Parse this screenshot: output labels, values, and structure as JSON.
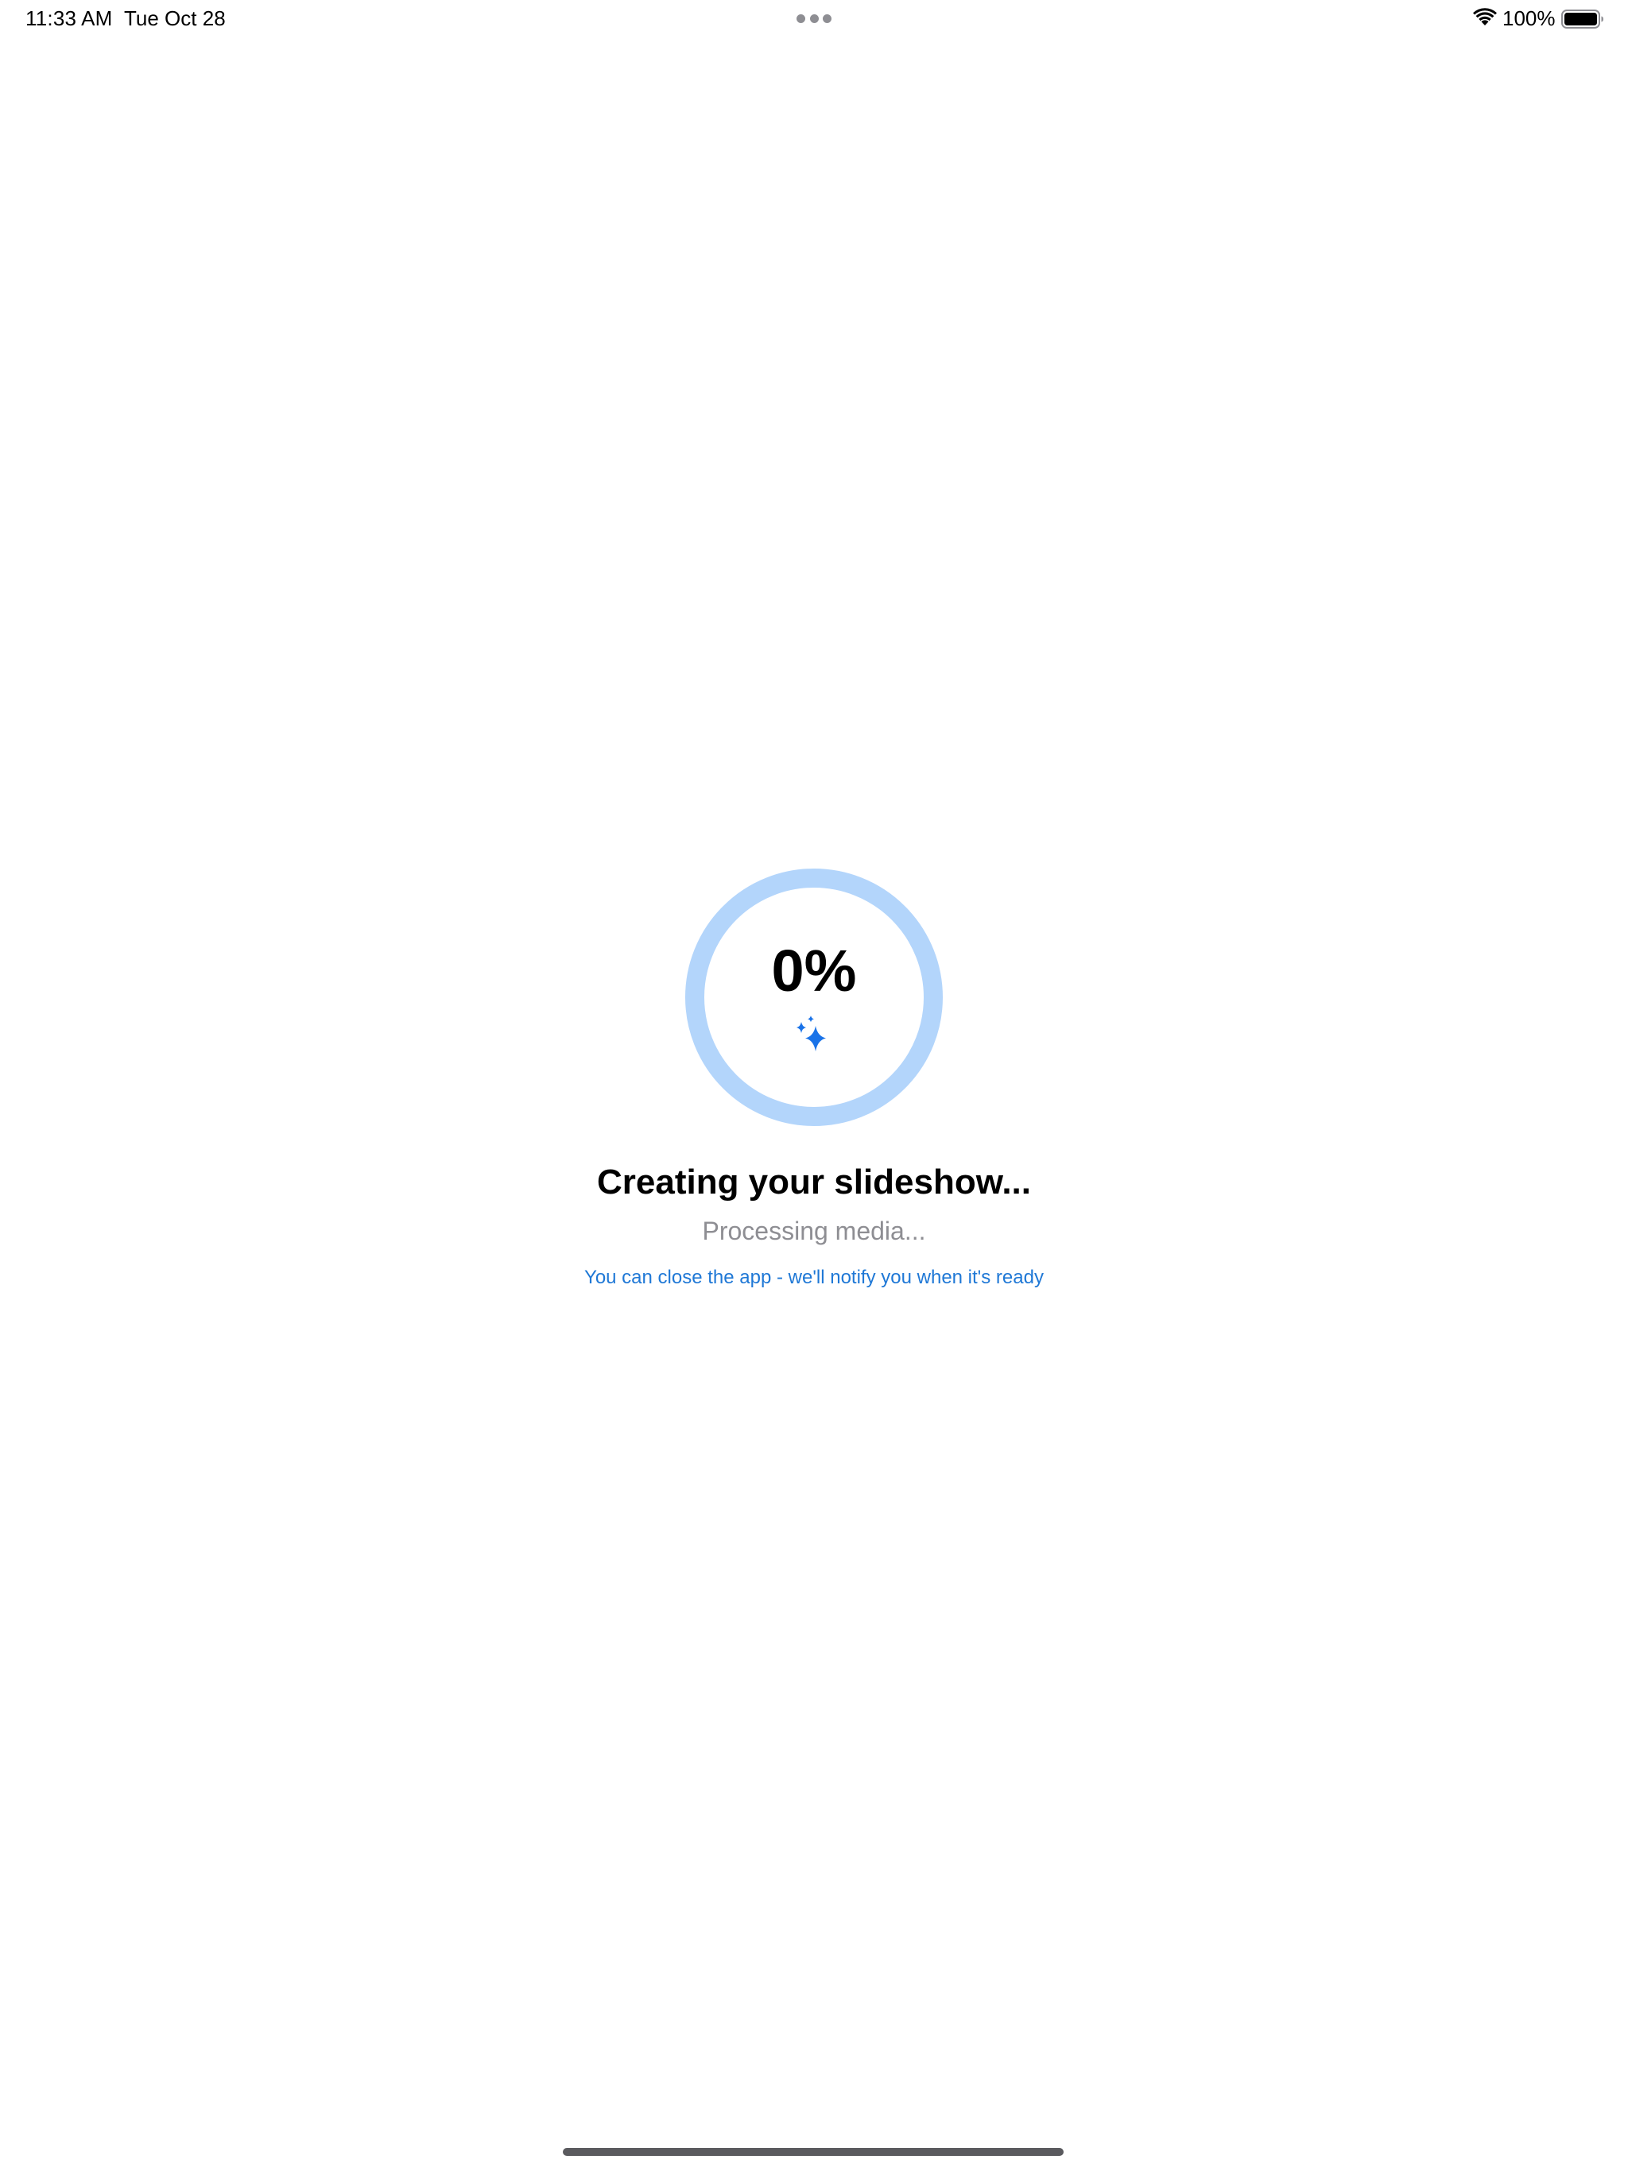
{
  "status_bar": {
    "time": "11:33 AM",
    "date": "Tue Oct 28",
    "battery_percent": "100%",
    "battery_level": 1.0,
    "icons": [
      "multitasking-dots-icon",
      "wifi-icon",
      "battery-icon"
    ]
  },
  "progress": {
    "label": "0%",
    "value": 0,
    "icon": "sparkle-icon",
    "colors": {
      "track": "#b3d5fb",
      "fill": "#1a73e8",
      "sparkle": "#1a73e8"
    }
  },
  "main": {
    "title": "Creating your slideshow...",
    "subtitle": "Processing media...",
    "notify_hint": "You can close the app - we'll notify you when it's ready"
  },
  "colors": {
    "background": "#ffffff",
    "title": "#000000",
    "subtitle": "#8e8e93",
    "hint": "#1f78d6"
  }
}
